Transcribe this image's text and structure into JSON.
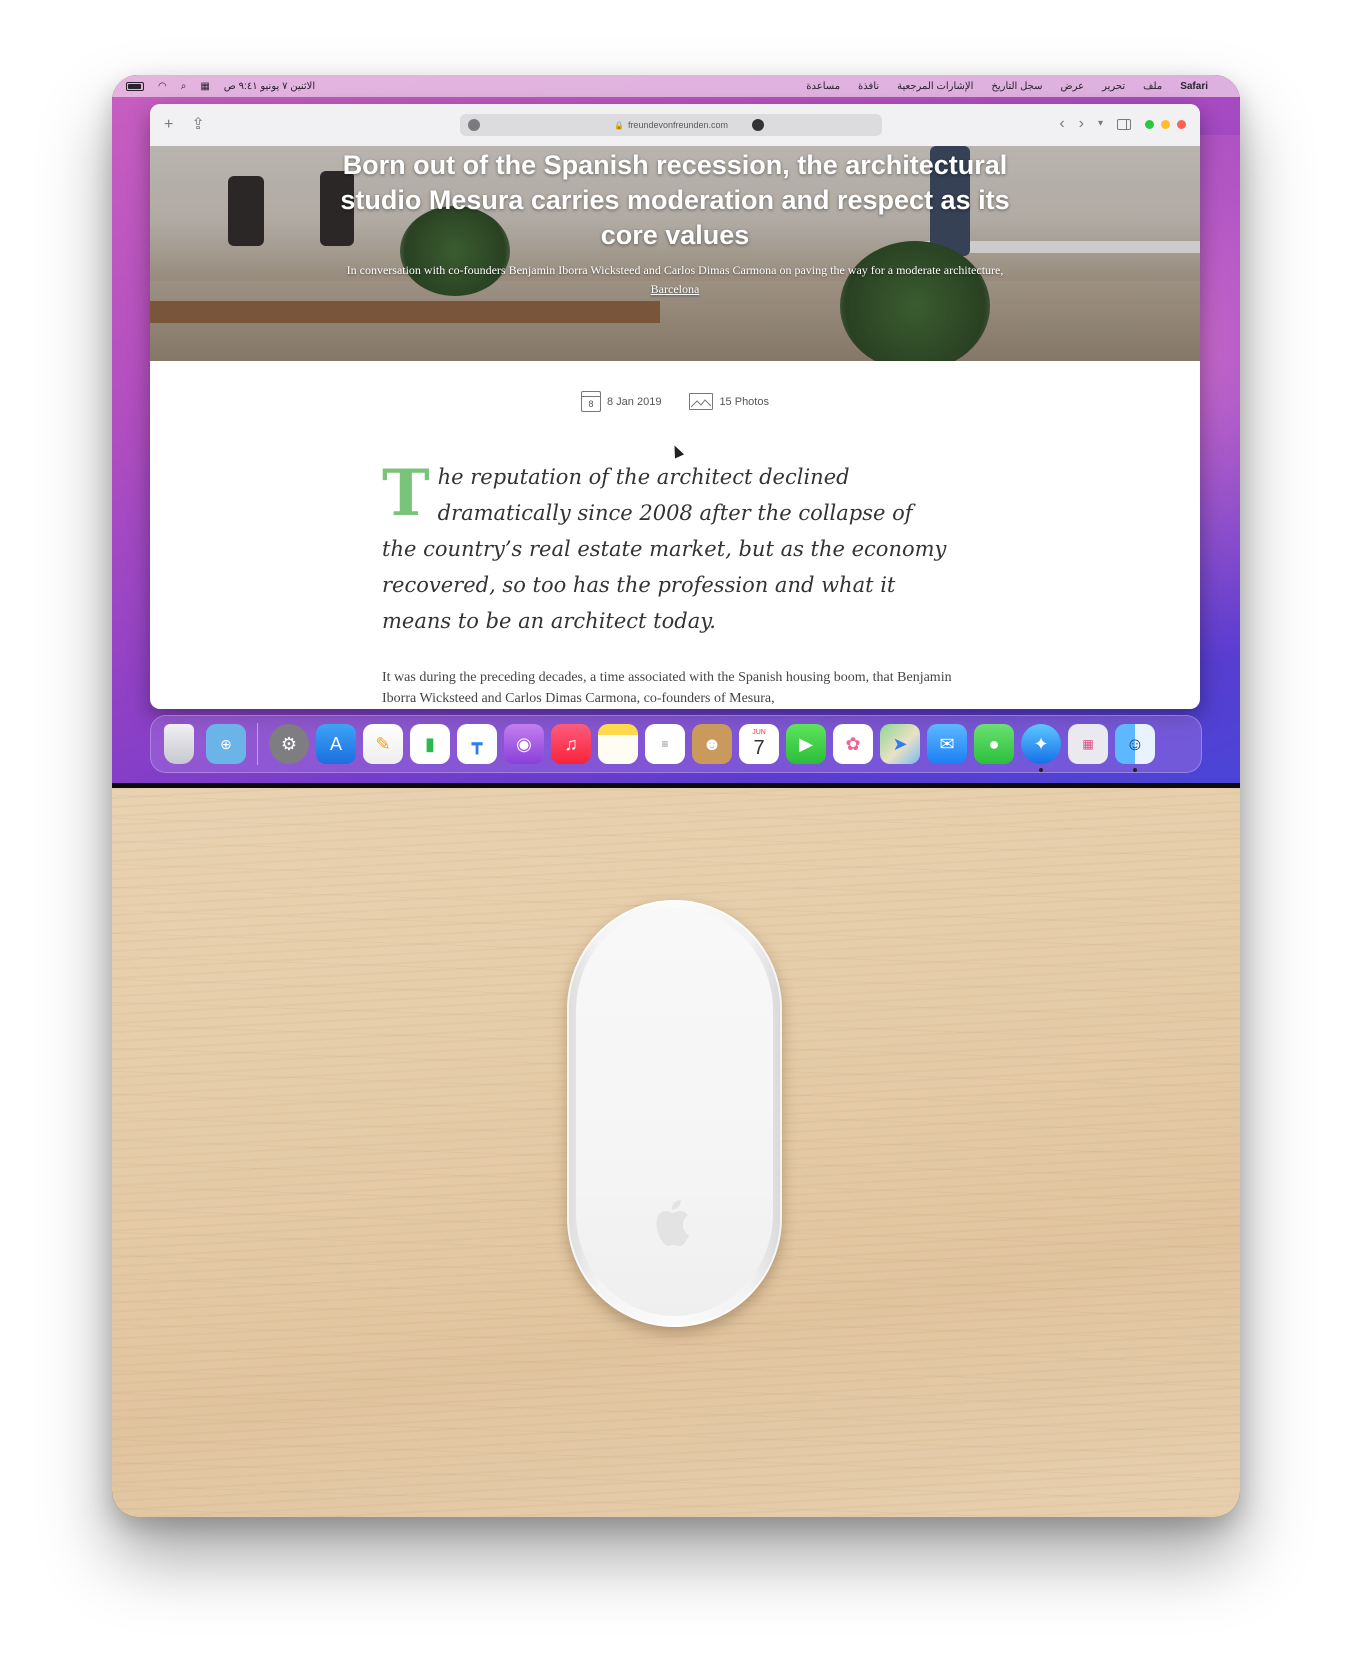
{
  "menubar": {
    "apple": "",
    "app_name": "Safari",
    "items": [
      "ملف",
      "تحرير",
      "عرض",
      "سجل التاريخ",
      "الإشارات المرجعية",
      "نافذة",
      "مساعدة"
    ],
    "clock": "الاثنين ٧ يونيو ٩:٤١ ص"
  },
  "safari": {
    "url": "freundevonfreunden.com",
    "traffic_colors": [
      "#ff5f57",
      "#febc2e",
      "#28c840"
    ]
  },
  "article": {
    "title": "Born out of the Spanish recession, the architectural studio Mesura carries moderation and respect as its core values",
    "subtitle": "In conversation with co-founders Benjamin Iborra Wicksteed and Carlos Dimas Carmona on paving the way for a moderate architecture,",
    "location": "Barcelona",
    "date_icon_day": "8",
    "date": "8 Jan 2019",
    "photos": "15 Photos",
    "dropcap": "T",
    "lede": "he reputation of the architect declined dramatically since 2008 after the collapse of the country’s real estate market, but as the economy recovered, so too has the profession and what it means to be an architect today.",
    "body": "It was during the preceding decades, a time associated with the Spanish housing boom, that Benjamin Iborra Wicksteed and Carlos Dimas Carmona, co-founders of Mesura,"
  },
  "dock": {
    "calendar_month": "JUN",
    "calendar_day": "7",
    "apps": [
      "trash-icon",
      "downloads-folder-icon",
      "system-preferences-icon",
      "app-store-icon",
      "pages-icon",
      "numbers-icon",
      "keynote-icon",
      "podcasts-icon",
      "music-icon",
      "notes-icon",
      "reminders-icon",
      "contacts-icon",
      "calendar-icon",
      "facetime-icon",
      "photos-icon",
      "maps-icon",
      "mail-icon",
      "messages-icon",
      "safari-icon",
      "launchpad-icon",
      "finder-icon"
    ]
  }
}
